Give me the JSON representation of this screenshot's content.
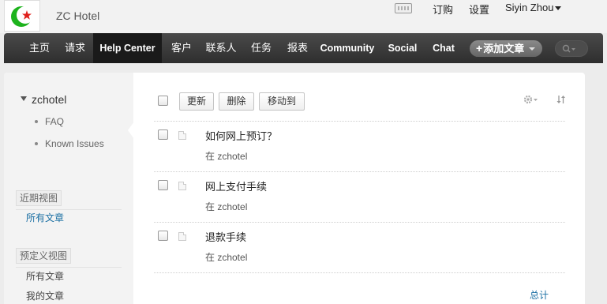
{
  "header": {
    "app_name": "ZC Hotel",
    "links": [
      "订购",
      "设置"
    ],
    "user": "Siyin Zhou"
  },
  "nav": {
    "items": [
      {
        "label": "主页"
      },
      {
        "label": "请求"
      },
      {
        "label": "Help Center",
        "active": true
      },
      {
        "label": "客户"
      },
      {
        "label": "联系人"
      },
      {
        "label": "任务"
      },
      {
        "label": "报表"
      },
      {
        "label": "Community"
      },
      {
        "label": "Social"
      },
      {
        "label": "Chat"
      }
    ],
    "add_button": "添加文章"
  },
  "sidebar": {
    "root": "zchotel",
    "children": [
      "FAQ",
      "Known Issues"
    ],
    "recent_title": "近期视图",
    "recent_items": [
      "所有文章"
    ],
    "predefined_title": "预定义视图",
    "predefined_items": [
      "所有文章",
      "我的文章"
    ]
  },
  "toolbar": {
    "update": "更新",
    "delete": "删除",
    "move_to": "移动到"
  },
  "articles": [
    {
      "title": "如何网上预订？",
      "category": "在 zchotel"
    },
    {
      "title": "网上支付手续",
      "category": "在 zchotel"
    },
    {
      "title": "退款手续",
      "category": "在 zchotel"
    }
  ],
  "footer": {
    "total": "总计"
  },
  "colors": {
    "nav_bg": "#333333",
    "link": "#1a6fa3",
    "logo_green": "#1db31d",
    "logo_red": "#e0201c"
  }
}
